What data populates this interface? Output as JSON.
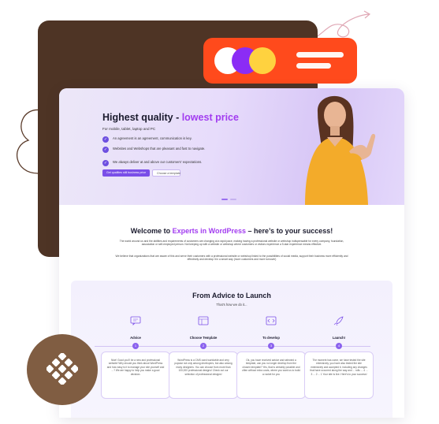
{
  "colors": {
    "brown_panel": "#4e3425",
    "orange_pill": "#ff4a1c",
    "purple_accent": "#a23cf0",
    "button_purple": "#7a4ee8",
    "badge_brown": "#805d42"
  },
  "hero": {
    "title_main": "Highest quality - ",
    "title_accent": "lowest price",
    "subtitle": "For mobile, tablet, laptop and PC",
    "features": [
      {
        "icon": "handshake-icon",
        "text": "An agreement is an agreement, communication is key."
      },
      {
        "icon": "globe-icon",
        "text": "Websites and Webshops that are pleasant and fast to navigate."
      },
      {
        "icon": "shield-check-icon",
        "text": "We always deliver at and above our customers' expectations."
      }
    ],
    "primary_button": "Get qualities still business price",
    "secondary_button": "Choose a template"
  },
  "welcome": {
    "title_before": "Welcome to ",
    "title_accent": "Experts in WordPress",
    "title_after": " – here’s to your success!",
    "paragraph_1": "The world around us and the abilities and requirements of customers are changing at a rapid pace, making having a professional website or webshop indispensable for every company, foundation, association or self-employed person. Not keeping up with a website or webshop where customers or visitors experience a 5-star experience means effective.",
    "paragraph_2": "We believe that organizations that are aware of this and serve their customers with a professional website or webshop linked to the possibilities of social media, support their business more efficiently and effectively and develop it in a smart way (more customers and more turnover)"
  },
  "launch": {
    "title": "From Advice to Launch",
    "subtitle": "That's how we do it...",
    "steps": [
      {
        "icon": "advice-icon",
        "title": "Advice",
        "number": "1",
        "text": "Nice! Good you'll be a new and professional website! Why should you think about WordPress and how easy is it to manage your site yourself and ...? We are happy to help you make a good decision."
      },
      {
        "icon": "template-icon",
        "title": "Choose Template",
        "number": "2",
        "text": "WordPress is a CMS used worldwide and very popular not only among developers, but also among many designers. You can choose from more than 100,000 professional designs! Check out our selection of professional designs!"
      },
      {
        "icon": "code-icon",
        "title": "To develop",
        "number": "3",
        "text": "Ok, you have received advice and selected a template, can you no longer develop from the chosen template? Yes, that is certainly possible and often without extra costs, where you want us to build a rocket for you"
      },
      {
        "icon": "rocket-icon",
        "title": "Launch!",
        "number": "4",
        "text": "The moment has come, we have tested the site extensively, you have also tested the site extensively and accepted it, including any changes that have occurred along the way and ... rolls ... 4 ... 3 ... 2 ... 1 Your site is live. Here's to your success!"
      }
    ]
  }
}
